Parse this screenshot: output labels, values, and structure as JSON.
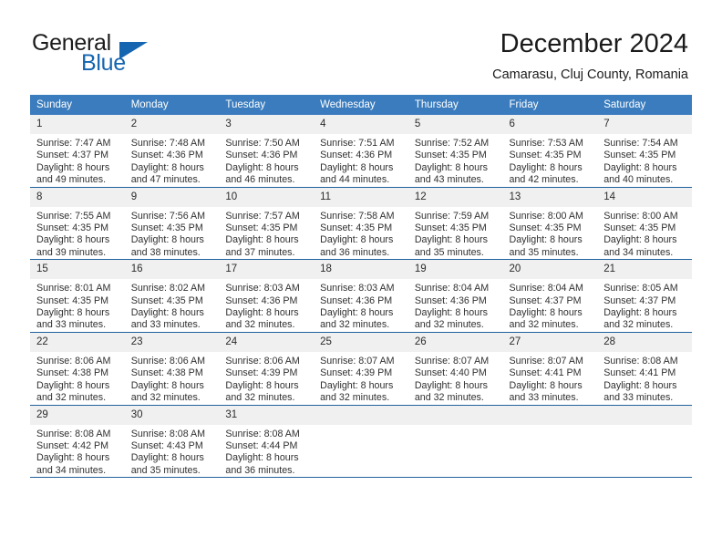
{
  "brand": {
    "name_part1": "General",
    "name_part2": "Blue",
    "accent_color": "#1565b0"
  },
  "header": {
    "month_title": "December 2024",
    "location": "Camarasu, Cluj County, Romania"
  },
  "calendar": {
    "header_color": "#3a7cbe",
    "separator_color": "#21619e",
    "daynum_band_color": "#f0f0f0",
    "weekdays": [
      "Sunday",
      "Monday",
      "Tuesday",
      "Wednesday",
      "Thursday",
      "Friday",
      "Saturday"
    ],
    "weeks": [
      [
        {
          "day": "1",
          "sunrise": "Sunrise: 7:47 AM",
          "sunset": "Sunset: 4:37 PM",
          "daylight1": "Daylight: 8 hours",
          "daylight2": "and 49 minutes."
        },
        {
          "day": "2",
          "sunrise": "Sunrise: 7:48 AM",
          "sunset": "Sunset: 4:36 PM",
          "daylight1": "Daylight: 8 hours",
          "daylight2": "and 47 minutes."
        },
        {
          "day": "3",
          "sunrise": "Sunrise: 7:50 AM",
          "sunset": "Sunset: 4:36 PM",
          "daylight1": "Daylight: 8 hours",
          "daylight2": "and 46 minutes."
        },
        {
          "day": "4",
          "sunrise": "Sunrise: 7:51 AM",
          "sunset": "Sunset: 4:36 PM",
          "daylight1": "Daylight: 8 hours",
          "daylight2": "and 44 minutes."
        },
        {
          "day": "5",
          "sunrise": "Sunrise: 7:52 AM",
          "sunset": "Sunset: 4:35 PM",
          "daylight1": "Daylight: 8 hours",
          "daylight2": "and 43 minutes."
        },
        {
          "day": "6",
          "sunrise": "Sunrise: 7:53 AM",
          "sunset": "Sunset: 4:35 PM",
          "daylight1": "Daylight: 8 hours",
          "daylight2": "and 42 minutes."
        },
        {
          "day": "7",
          "sunrise": "Sunrise: 7:54 AM",
          "sunset": "Sunset: 4:35 PM",
          "daylight1": "Daylight: 8 hours",
          "daylight2": "and 40 minutes."
        }
      ],
      [
        {
          "day": "8",
          "sunrise": "Sunrise: 7:55 AM",
          "sunset": "Sunset: 4:35 PM",
          "daylight1": "Daylight: 8 hours",
          "daylight2": "and 39 minutes."
        },
        {
          "day": "9",
          "sunrise": "Sunrise: 7:56 AM",
          "sunset": "Sunset: 4:35 PM",
          "daylight1": "Daylight: 8 hours",
          "daylight2": "and 38 minutes."
        },
        {
          "day": "10",
          "sunrise": "Sunrise: 7:57 AM",
          "sunset": "Sunset: 4:35 PM",
          "daylight1": "Daylight: 8 hours",
          "daylight2": "and 37 minutes."
        },
        {
          "day": "11",
          "sunrise": "Sunrise: 7:58 AM",
          "sunset": "Sunset: 4:35 PM",
          "daylight1": "Daylight: 8 hours",
          "daylight2": "and 36 minutes."
        },
        {
          "day": "12",
          "sunrise": "Sunrise: 7:59 AM",
          "sunset": "Sunset: 4:35 PM",
          "daylight1": "Daylight: 8 hours",
          "daylight2": "and 35 minutes."
        },
        {
          "day": "13",
          "sunrise": "Sunrise: 8:00 AM",
          "sunset": "Sunset: 4:35 PM",
          "daylight1": "Daylight: 8 hours",
          "daylight2": "and 35 minutes."
        },
        {
          "day": "14",
          "sunrise": "Sunrise: 8:00 AM",
          "sunset": "Sunset: 4:35 PM",
          "daylight1": "Daylight: 8 hours",
          "daylight2": "and 34 minutes."
        }
      ],
      [
        {
          "day": "15",
          "sunrise": "Sunrise: 8:01 AM",
          "sunset": "Sunset: 4:35 PM",
          "daylight1": "Daylight: 8 hours",
          "daylight2": "and 33 minutes."
        },
        {
          "day": "16",
          "sunrise": "Sunrise: 8:02 AM",
          "sunset": "Sunset: 4:35 PM",
          "daylight1": "Daylight: 8 hours",
          "daylight2": "and 33 minutes."
        },
        {
          "day": "17",
          "sunrise": "Sunrise: 8:03 AM",
          "sunset": "Sunset: 4:36 PM",
          "daylight1": "Daylight: 8 hours",
          "daylight2": "and 32 minutes."
        },
        {
          "day": "18",
          "sunrise": "Sunrise: 8:03 AM",
          "sunset": "Sunset: 4:36 PM",
          "daylight1": "Daylight: 8 hours",
          "daylight2": "and 32 minutes."
        },
        {
          "day": "19",
          "sunrise": "Sunrise: 8:04 AM",
          "sunset": "Sunset: 4:36 PM",
          "daylight1": "Daylight: 8 hours",
          "daylight2": "and 32 minutes."
        },
        {
          "day": "20",
          "sunrise": "Sunrise: 8:04 AM",
          "sunset": "Sunset: 4:37 PM",
          "daylight1": "Daylight: 8 hours",
          "daylight2": "and 32 minutes."
        },
        {
          "day": "21",
          "sunrise": "Sunrise: 8:05 AM",
          "sunset": "Sunset: 4:37 PM",
          "daylight1": "Daylight: 8 hours",
          "daylight2": "and 32 minutes."
        }
      ],
      [
        {
          "day": "22",
          "sunrise": "Sunrise: 8:06 AM",
          "sunset": "Sunset: 4:38 PM",
          "daylight1": "Daylight: 8 hours",
          "daylight2": "and 32 minutes."
        },
        {
          "day": "23",
          "sunrise": "Sunrise: 8:06 AM",
          "sunset": "Sunset: 4:38 PM",
          "daylight1": "Daylight: 8 hours",
          "daylight2": "and 32 minutes."
        },
        {
          "day": "24",
          "sunrise": "Sunrise: 8:06 AM",
          "sunset": "Sunset: 4:39 PM",
          "daylight1": "Daylight: 8 hours",
          "daylight2": "and 32 minutes."
        },
        {
          "day": "25",
          "sunrise": "Sunrise: 8:07 AM",
          "sunset": "Sunset: 4:39 PM",
          "daylight1": "Daylight: 8 hours",
          "daylight2": "and 32 minutes."
        },
        {
          "day": "26",
          "sunrise": "Sunrise: 8:07 AM",
          "sunset": "Sunset: 4:40 PM",
          "daylight1": "Daylight: 8 hours",
          "daylight2": "and 32 minutes."
        },
        {
          "day": "27",
          "sunrise": "Sunrise: 8:07 AM",
          "sunset": "Sunset: 4:41 PM",
          "daylight1": "Daylight: 8 hours",
          "daylight2": "and 33 minutes."
        },
        {
          "day": "28",
          "sunrise": "Sunrise: 8:08 AM",
          "sunset": "Sunset: 4:41 PM",
          "daylight1": "Daylight: 8 hours",
          "daylight2": "and 33 minutes."
        }
      ],
      [
        {
          "day": "29",
          "sunrise": "Sunrise: 8:08 AM",
          "sunset": "Sunset: 4:42 PM",
          "daylight1": "Daylight: 8 hours",
          "daylight2": "and 34 minutes."
        },
        {
          "day": "30",
          "sunrise": "Sunrise: 8:08 AM",
          "sunset": "Sunset: 4:43 PM",
          "daylight1": "Daylight: 8 hours",
          "daylight2": "and 35 minutes."
        },
        {
          "day": "31",
          "sunrise": "Sunrise: 8:08 AM",
          "sunset": "Sunset: 4:44 PM",
          "daylight1": "Daylight: 8 hours",
          "daylight2": "and 36 minutes."
        },
        {
          "day": "",
          "sunrise": "",
          "sunset": "",
          "daylight1": "",
          "daylight2": ""
        },
        {
          "day": "",
          "sunrise": "",
          "sunset": "",
          "daylight1": "",
          "daylight2": ""
        },
        {
          "day": "",
          "sunrise": "",
          "sunset": "",
          "daylight1": "",
          "daylight2": ""
        },
        {
          "day": "",
          "sunrise": "",
          "sunset": "",
          "daylight1": "",
          "daylight2": ""
        }
      ]
    ]
  }
}
